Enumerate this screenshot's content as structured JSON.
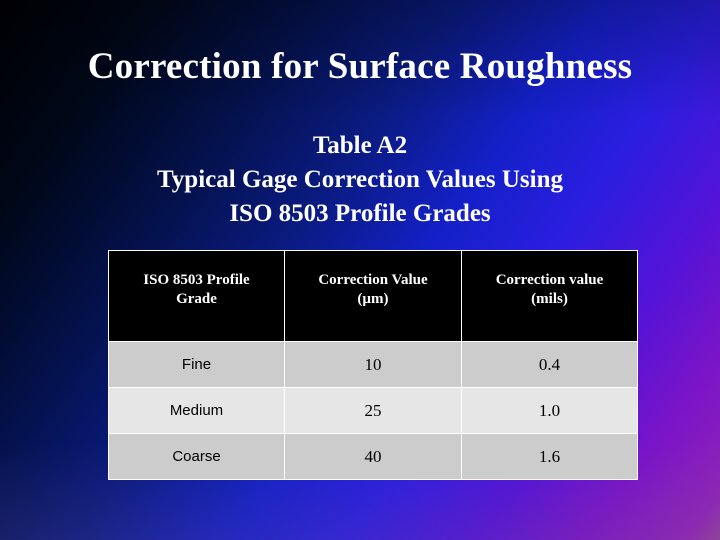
{
  "slide": {
    "title": "Correction for Surface Roughness",
    "background": {
      "start_color": "#000004",
      "mid_color": "#1420c8",
      "end_color": "#93409e",
      "direction": "diagonal top-left to bottom-right"
    }
  },
  "subtitle": {
    "lines": [
      "Table A2",
      "Typical Gage Correction Values Using",
      "ISO 8503 Profile Grades"
    ]
  },
  "table": {
    "caption": "Table A2",
    "header_background": "#000000",
    "header_text_color": "#ffffff",
    "row_shade_a": "#cccccc",
    "row_shade_b": "#e6e6e6",
    "columns": [
      {
        "line1": "ISO 8503 Profile",
        "line2": "Grade"
      },
      {
        "line1": "Correction Value",
        "line2": "(µm)"
      },
      {
        "line1": "Correction value",
        "line2": "(mils)"
      }
    ],
    "rows": [
      {
        "grade": "Fine",
        "microns": "10",
        "mils": "0.4"
      },
      {
        "grade": "Medium",
        "microns": "25",
        "mils": "1.0"
      },
      {
        "grade": "Coarse",
        "microns": "40",
        "mils": "1.6"
      }
    ]
  }
}
